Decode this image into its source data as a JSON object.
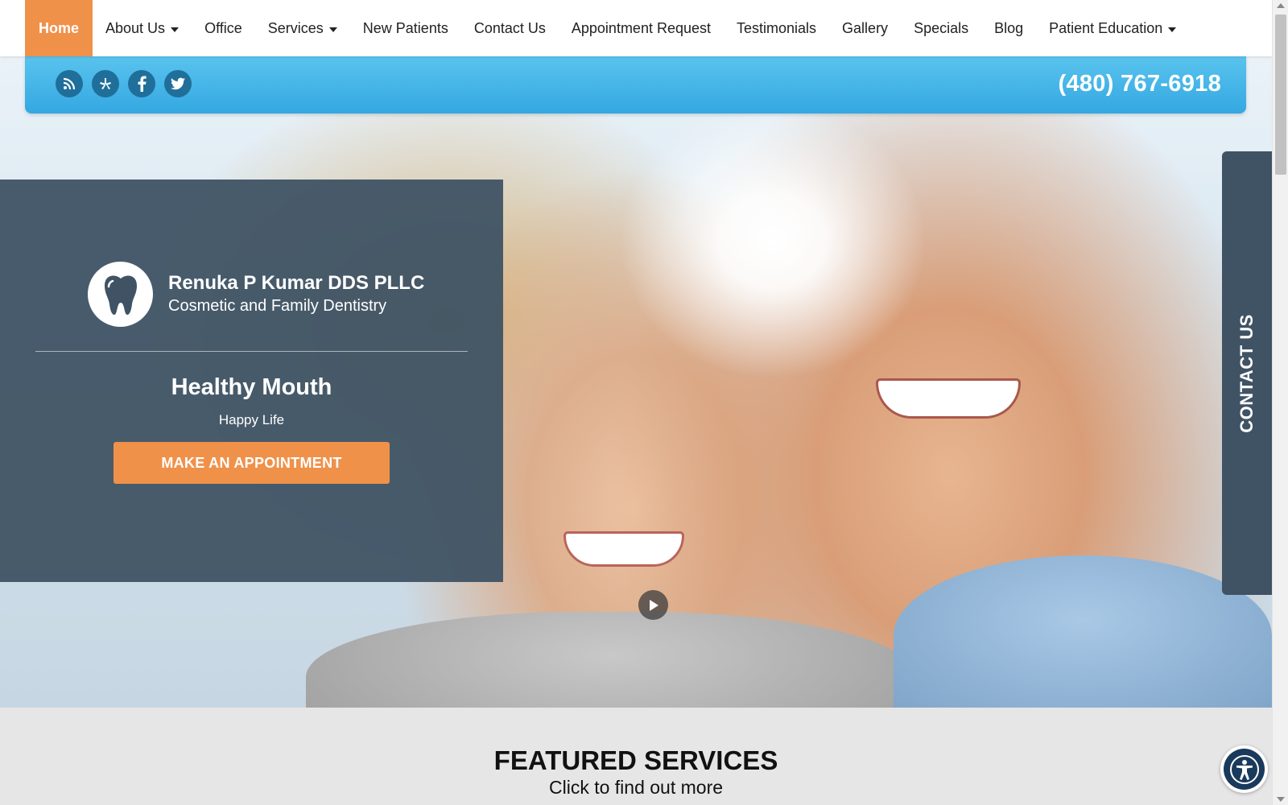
{
  "nav": {
    "items": [
      {
        "label": "Home",
        "active": true,
        "dropdown": false
      },
      {
        "label": "About Us",
        "active": false,
        "dropdown": true
      },
      {
        "label": "Office",
        "active": false,
        "dropdown": false
      },
      {
        "label": "Services",
        "active": false,
        "dropdown": true
      },
      {
        "label": "New Patients",
        "active": false,
        "dropdown": false
      },
      {
        "label": "Contact Us",
        "active": false,
        "dropdown": false
      },
      {
        "label": "Appointment Request",
        "active": false,
        "dropdown": false
      },
      {
        "label": "Testimonials",
        "active": false,
        "dropdown": false
      },
      {
        "label": "Gallery",
        "active": false,
        "dropdown": false
      },
      {
        "label": "Specials",
        "active": false,
        "dropdown": false
      },
      {
        "label": "Blog",
        "active": false,
        "dropdown": false
      },
      {
        "label": "Patient Education",
        "active": false,
        "dropdown": true
      }
    ]
  },
  "topbar": {
    "social": [
      "rss-icon",
      "yelp-icon",
      "facebook-icon",
      "twitter-icon"
    ],
    "phone": "(480) 767-6918"
  },
  "hero": {
    "brand_name": "Renuka P Kumar DDS PLLC",
    "brand_sub": "Cosmetic and Family Dentistry",
    "slogan": "Healthy Mouth",
    "slogan_sub": "Happy Life",
    "cta": "MAKE AN APPOINTMENT"
  },
  "side_tab": {
    "label": "CONTACT US"
  },
  "featured": {
    "title": "FEATURED SERVICES",
    "subtitle": "Click to find out more"
  },
  "colors": {
    "accent": "#f0914a",
    "bar_blue": "#34a8e2",
    "panel": "#3f5364",
    "icon_blue": "#1f6f9a"
  }
}
